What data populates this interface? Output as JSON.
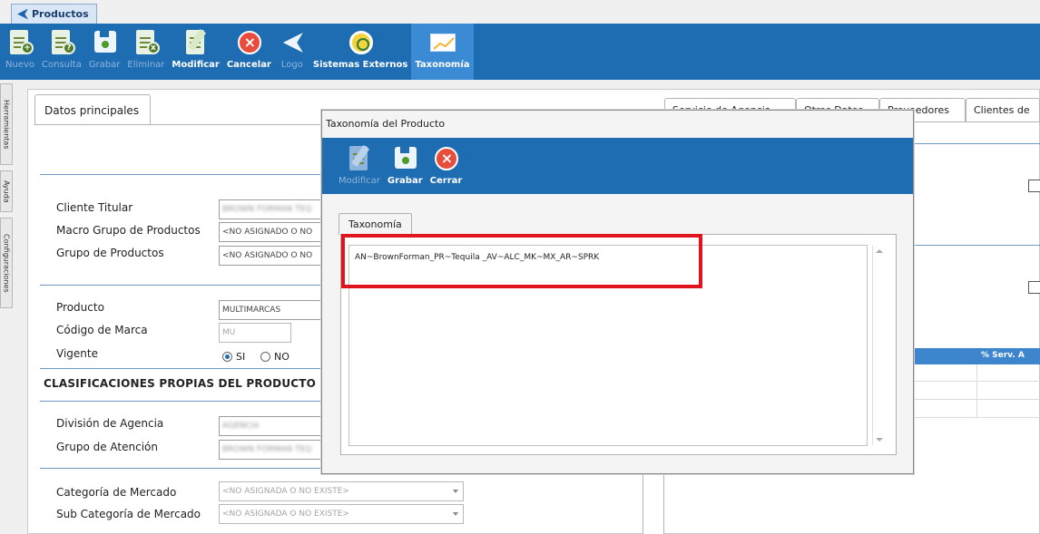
{
  "window": {
    "tab_label": "Productos"
  },
  "ribbon": {
    "buttons": [
      {
        "label": "Nuevo",
        "icon": "new-doc-icon",
        "state": "disabled"
      },
      {
        "label": "Consulta",
        "icon": "query-doc-icon",
        "state": "disabled"
      },
      {
        "label": "Grabar",
        "icon": "save-icon",
        "state": "disabled"
      },
      {
        "label": "Eliminar",
        "icon": "delete-doc-icon",
        "state": "disabled"
      },
      {
        "label": "Modificar",
        "icon": "edit-icon",
        "state": "enabled"
      },
      {
        "label": "Cancelar",
        "icon": "cancel-icon",
        "state": "enabled"
      },
      {
        "label": "Logo",
        "icon": "logo-icon",
        "state": "disabled"
      },
      {
        "label": "Sistemas Externos",
        "icon": "globe-icon",
        "state": "enabled"
      },
      {
        "label": "Taxonomía",
        "icon": "chart-icon",
        "state": "active"
      }
    ]
  },
  "side_tabs": [
    "Herramientas",
    "Ayuda",
    "Configuraciones"
  ],
  "main": {
    "tab": "Datos principales",
    "right_tabs": [
      "Servicio de Agencia",
      "Otros Datos",
      "Proveedores",
      "Clientes de"
    ],
    "fields": {
      "cliente_titular_label": "Cliente Titular",
      "cliente_titular_value": "BROWN FORMAN TEQ",
      "macro_grupo_label": "Macro Grupo de Productos",
      "macro_grupo_value": "<NO ASIGNADO O NO",
      "grupo_label": "Grupo de Productos",
      "grupo_value": "<NO ASIGNADO O NO",
      "producto_label": "Producto",
      "producto_value": "MULTIMARCAS",
      "codigo_marca_label": "Código de Marca",
      "codigo_marca_value": "MU",
      "vigente_label": "Vigente",
      "vigente_si": "SI",
      "vigente_no": "NO",
      "division_label": "División de Agencia",
      "division_value": "AGENCIA",
      "grupo_atencion_label": "Grupo de Atención",
      "grupo_atencion_value": "BROWN FORMAN TEQ",
      "categoria_label": "Categoría de Mercado",
      "categoria_value": "<NO ASIGNADA O NO EXISTE>",
      "subcategoria_label": "Sub Categoría de Mercado",
      "subcategoria_value": "<NO ASIGNADA O NO EXISTE>"
    },
    "section_title": "CLASIFICACIONES PROPIAS DEL PRODUCTO",
    "grid_header": "% Serv. A"
  },
  "modal": {
    "title": "Taxonomía del Producto",
    "toolbar": [
      {
        "label": "Modificar",
        "icon": "edit-icon",
        "state": "disabled"
      },
      {
        "label": "Grabar",
        "icon": "save-icon",
        "state": "enabled"
      },
      {
        "label": "Cerrar",
        "icon": "close-icon",
        "state": "enabled"
      }
    ],
    "tab": "Taxonomía",
    "text_value": "AN~BrownForman_PR~Tequila _AV~ALC_MK~MX_AR~SPRK"
  },
  "colors": {
    "ribbon": "#1e6db3",
    "highlight": "#e0141e",
    "grid_header": "#3d86cd"
  }
}
